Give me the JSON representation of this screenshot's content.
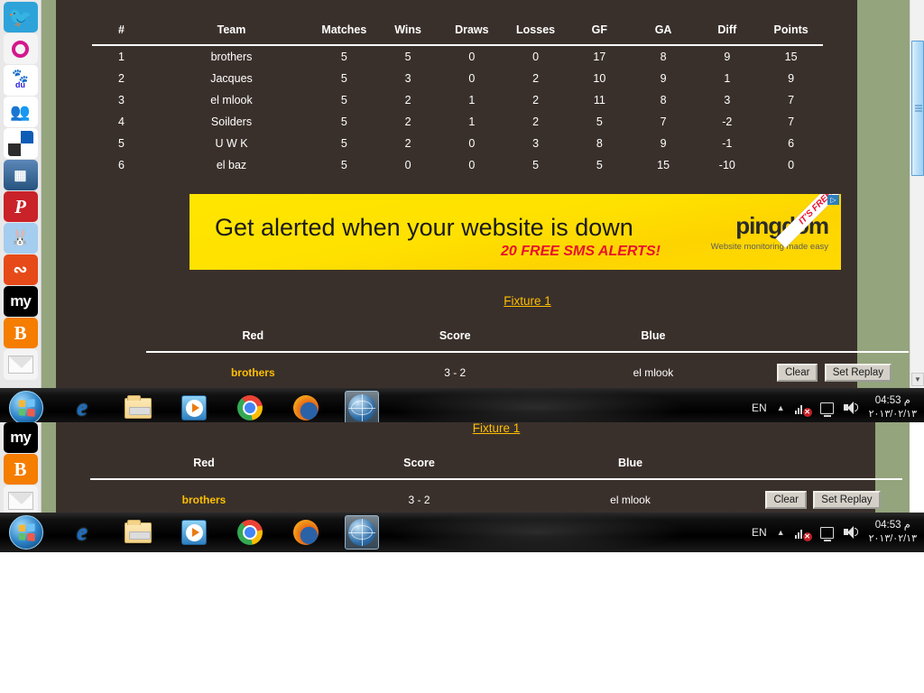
{
  "standings": {
    "headers": [
      "#",
      "Team",
      "Matches",
      "Wins",
      "Draws",
      "Losses",
      "GF",
      "GA",
      "Diff",
      "Points"
    ],
    "rows": [
      {
        "rank": "1",
        "team": "brothers",
        "matches": "5",
        "wins": "5",
        "draws": "0",
        "losses": "0",
        "gf": "17",
        "ga": "8",
        "diff": "9",
        "points": "15"
      },
      {
        "rank": "2",
        "team": "Jacques",
        "matches": "5",
        "wins": "3",
        "draws": "0",
        "losses": "2",
        "gf": "10",
        "ga": "9",
        "diff": "1",
        "points": "9"
      },
      {
        "rank": "3",
        "team": "el mlook",
        "matches": "5",
        "wins": "2",
        "draws": "1",
        "losses": "2",
        "gf": "11",
        "ga": "8",
        "diff": "3",
        "points": "7"
      },
      {
        "rank": "4",
        "team": "Soilders",
        "matches": "5",
        "wins": "2",
        "draws": "1",
        "losses": "2",
        "gf": "5",
        "ga": "7",
        "diff": "-2",
        "points": "7"
      },
      {
        "rank": "5",
        "team": "U W K",
        "matches": "5",
        "wins": "2",
        "draws": "0",
        "losses": "3",
        "gf": "8",
        "ga": "9",
        "diff": "-1",
        "points": "6"
      },
      {
        "rank": "6",
        "team": "el baz",
        "matches": "5",
        "wins": "0",
        "draws": "0",
        "losses": "5",
        "gf": "5",
        "ga": "15",
        "diff": "-10",
        "points": "0"
      }
    ]
  },
  "ad": {
    "headline": "Get alerted when your website is down",
    "subline": "20 FREE SMS ALERTS!",
    "brand": "pingdom",
    "tagline": "Website monitoring made easy",
    "ribbon": "IT'S FREE",
    "adchoices": "▷",
    "bg_color": "#ffe600",
    "accent_color": "#e8112d"
  },
  "fixture": {
    "title": "Fixture 1",
    "headers": {
      "red": "Red",
      "score": "Score",
      "blue": "Blue"
    },
    "match": {
      "red_team": "brothers",
      "score": "3 - 2",
      "blue_team": "el mlook"
    },
    "buttons": {
      "clear": "Clear",
      "set_replay": "Set Replay"
    },
    "link_color": "#ffbf00"
  },
  "share_rail": {
    "items": [
      {
        "name": "twitter",
        "glyph": "🐦"
      },
      {
        "name": "orkut",
        "glyph": ""
      },
      {
        "name": "baidu",
        "glyph": "du"
      },
      {
        "name": "msn-messenger",
        "glyph": "👥"
      },
      {
        "name": "delicious",
        "glyph": ""
      },
      {
        "name": "diigo",
        "glyph": "▦"
      },
      {
        "name": "pinterest",
        "glyph": "P"
      },
      {
        "name": "reddit",
        "glyph": "◉"
      },
      {
        "name": "stumbleupon",
        "glyph": "su"
      },
      {
        "name": "myspace",
        "glyph": "my"
      },
      {
        "name": "blogger",
        "glyph": "B"
      },
      {
        "name": "email",
        "glyph": ""
      }
    ]
  },
  "taskbar": {
    "start_label": "Start",
    "items": [
      {
        "name": "internet-explorer",
        "label": "Internet Explorer"
      },
      {
        "name": "windows-explorer",
        "label": "Windows Explorer"
      },
      {
        "name": "windows-media-player",
        "label": "Windows Media Player"
      },
      {
        "name": "google-chrome",
        "label": "Google Chrome"
      },
      {
        "name": "mozilla-firefox",
        "label": "Mozilla Firefox"
      },
      {
        "name": "browser-window",
        "label": "Browser",
        "active": true
      }
    ],
    "tray": {
      "language": "EN",
      "show_hidden": "▲",
      "time": "04:53 م",
      "date": "٢٠١٣/٠٢/١٣"
    }
  },
  "scrollbar": {
    "down_arrow": "▼"
  }
}
